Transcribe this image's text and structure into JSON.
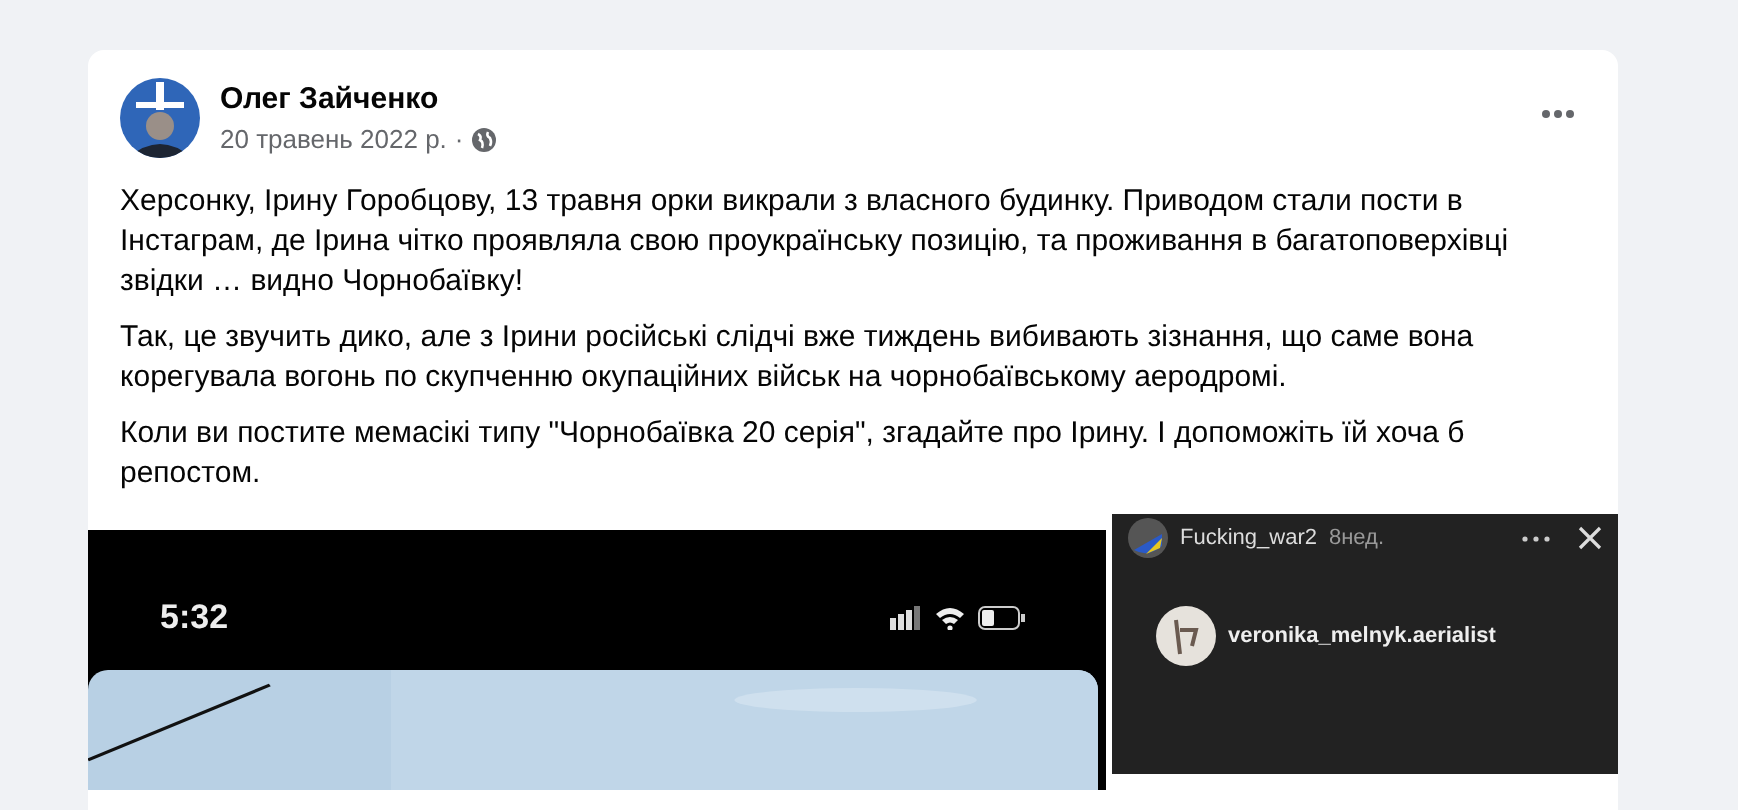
{
  "post": {
    "author": "Олег Зайченко",
    "date": "20 травень 2022 р.",
    "separator": "·",
    "paragraphs": [
      "Херсонку, Ірину Горобцову, 13 травня орки викрали з власного будинку. Приводом стали пости в Інстаграм, де Ірина чітко проявляла свою проукраїнську позицію, та проживання в багатоповерхівці звідки … видно Чорнобаївку!",
      "Так, це звучить дико, але з Ірини російські слідчі вже тиждень вибивають зізнання, що саме вона корегувала вогонь по скупченню окупаційних військ на чорнобаївському аеродромі.",
      "Коли ви постите мемасікі типу \"Чорнобаївка 20 серія\", згадайте про Ірину. І допоможіть їй хоча б репостом."
    ]
  },
  "images": [
    {
      "kind": "phone",
      "time": "5:32"
    },
    {
      "kind": "story",
      "user": "Fucking_war2",
      "age": "8нед.",
      "mention": "veronika_melnyk.aerialist"
    }
  ]
}
